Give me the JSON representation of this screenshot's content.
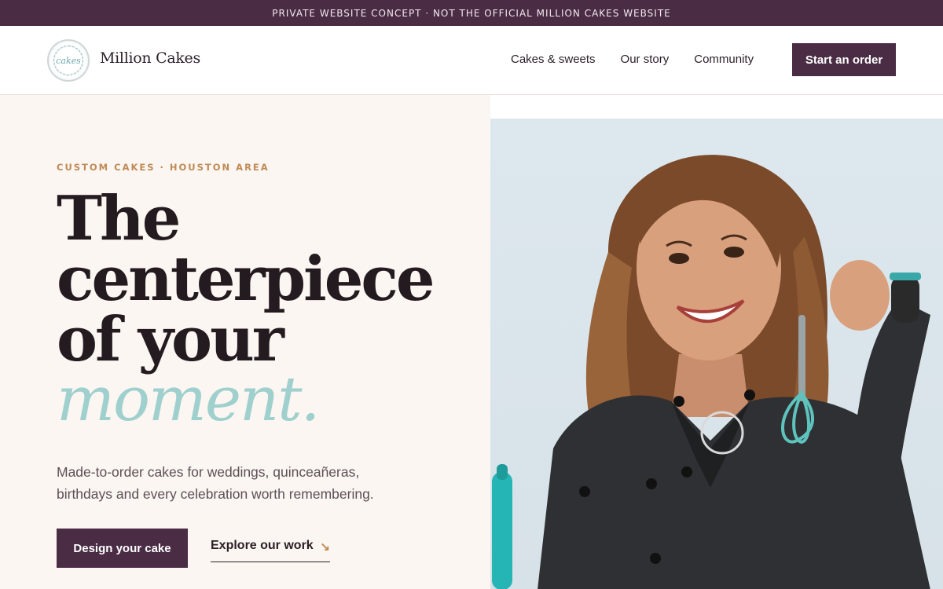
{
  "banner": {
    "text": "PRIVATE WEBSITE CONCEPT · NOT THE OFFICIAL MILLION CAKES WEBSITE"
  },
  "header": {
    "brand_name": "Million Cakes",
    "logo_text": "cakes",
    "nav": [
      {
        "label": "Cakes & sweets"
      },
      {
        "label": "Our story"
      },
      {
        "label": "Community"
      }
    ],
    "cta_label": "Start an order"
  },
  "hero": {
    "eyebrow": "CUSTOM CAKES · HOUSTON AREA",
    "headline_lines": [
      "The",
      "centerpiece",
      "of your"
    ],
    "headline_accent": "moment.",
    "subcopy": "Made-to-order cakes for weddings, quinceañeras, birthdays and every celebration worth remembering.",
    "primary_button": "Design your cake",
    "secondary_link": "Explore our work",
    "secondary_icon": "arrow-down-right-icon"
  },
  "colors": {
    "accent_plum": "#4a2c45",
    "accent_gold": "#c08a55",
    "accent_teal": "#9fd0cd",
    "background": "#fbf6f1"
  }
}
